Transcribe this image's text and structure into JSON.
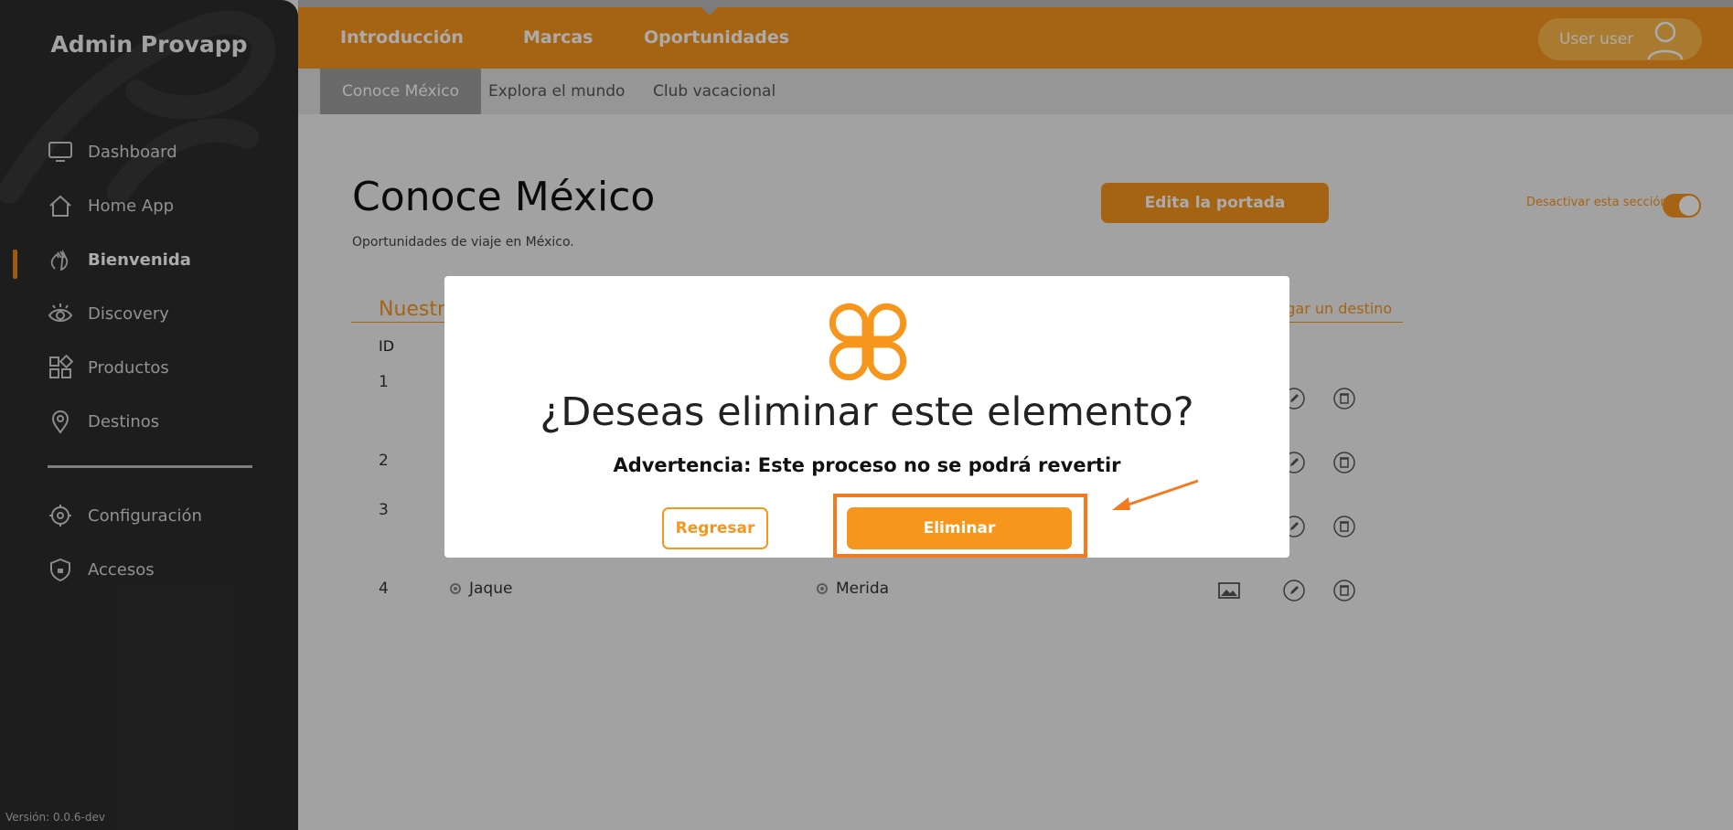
{
  "sidebar": {
    "brand": "Admin Provapp",
    "items": [
      {
        "label": "Dashboard",
        "icon": "monitor-icon"
      },
      {
        "label": "Home App",
        "icon": "home-icon"
      },
      {
        "label": "Bienvenida",
        "icon": "waving-hand-icon",
        "active": true
      },
      {
        "label": "Discovery",
        "icon": "eye-icon"
      },
      {
        "label": "Productos",
        "icon": "grid-icon"
      },
      {
        "label": "Destinos",
        "icon": "location-pin-icon"
      }
    ],
    "settings_items": [
      {
        "label": "Configuración",
        "icon": "gear-icon"
      },
      {
        "label": "Accesos",
        "icon": "shield-icon"
      }
    ],
    "version": "Versión: 0.0.6-dev"
  },
  "topbar": {
    "nav": [
      "Introducción",
      "Marcas",
      "Oportunidades"
    ],
    "active_nav": "Oportunidades",
    "user_label": "User user"
  },
  "subnav": {
    "tabs": [
      "Conoce México",
      "Explora el mundo",
      "Club vacacional"
    ],
    "active_tab": "Conoce México"
  },
  "page": {
    "title": "Conoce México",
    "subtitle": "Oportunidades de viaje en México.",
    "edit_cover_button": "Edita la portada",
    "toggle_label": "Desactivar esta sección",
    "section_title": "Nuestr",
    "add_destination": "gregar un destino",
    "column_id": "ID",
    "rows": [
      {
        "id": "1"
      },
      {
        "id": "2"
      },
      {
        "id": "3"
      },
      {
        "id": "4",
        "name": "Jaque",
        "destination": "Merida"
      }
    ]
  },
  "modal": {
    "title": "¿Deseas eliminar este elemento?",
    "warning": "Advertencia: Este proceso no se podrá revertir",
    "back_button": "Regresar",
    "delete_button": "Eliminar"
  },
  "colors": {
    "accent": "#f7961d",
    "sidebar_bg": "#2c2c2c",
    "highlight": "#f47a20"
  }
}
